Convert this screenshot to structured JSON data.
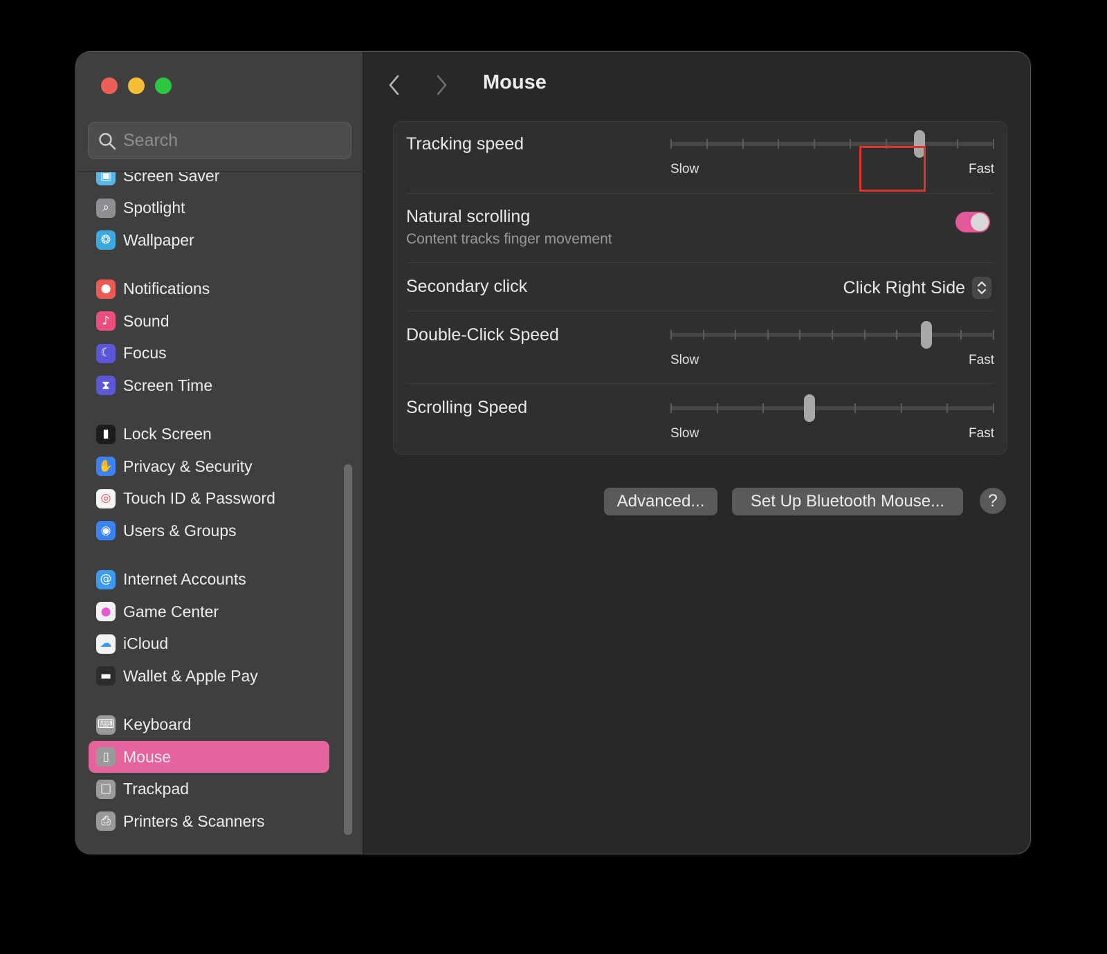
{
  "window": {
    "traffic_lights": {
      "close": "#ec5f57",
      "minimize": "#f3be33",
      "maximize": "#2bc840"
    }
  },
  "search": {
    "placeholder": "Search",
    "icon": "magnifying-glass-icon"
  },
  "sidebar": {
    "items": [
      {
        "label": "Screen Saver",
        "icon": "screen-saver-icon",
        "color": "#57b8e8"
      },
      {
        "label": "Spotlight",
        "icon": "spotlight-icon",
        "color": "#8e8e93"
      },
      {
        "label": "Wallpaper",
        "icon": "wallpaper-icon",
        "color": "#3aa9e0"
      },
      {
        "label": "Notifications",
        "icon": "notifications-icon",
        "color": "#ec5a56"
      },
      {
        "label": "Sound",
        "icon": "sound-icon",
        "color": "#ea4f7d"
      },
      {
        "label": "Focus",
        "icon": "focus-icon",
        "color": "#5b57d6"
      },
      {
        "label": "Screen Time",
        "icon": "screen-time-icon",
        "color": "#5b57d6"
      },
      {
        "label": "Lock Screen",
        "icon": "lock-icon",
        "color": "#1c1c1e"
      },
      {
        "label": "Privacy & Security",
        "icon": "hand-icon",
        "color": "#3b82f6"
      },
      {
        "label": "Touch ID & Password",
        "icon": "fingerprint-icon",
        "color": "#f4f4f4"
      },
      {
        "label": "Users & Groups",
        "icon": "users-icon",
        "color": "#3b82f6"
      },
      {
        "label": "Internet Accounts",
        "icon": "at-icon",
        "color": "#3b9bf0"
      },
      {
        "label": "Game Center",
        "icon": "game-center-icon",
        "color": "#f2f2f2"
      },
      {
        "label": "iCloud",
        "icon": "cloud-icon",
        "color": "#f2f2f2"
      },
      {
        "label": "Wallet & Apple Pay",
        "icon": "wallet-icon",
        "color": "#2c2c2e"
      },
      {
        "label": "Keyboard",
        "icon": "keyboard-icon",
        "color": "#9a9a9a"
      },
      {
        "label": "Mouse",
        "icon": "mouse-icon",
        "color": "#9a9a9a",
        "selected": true
      },
      {
        "label": "Trackpad",
        "icon": "trackpad-icon",
        "color": "#9a9a9a"
      },
      {
        "label": "Printers & Scanners",
        "icon": "printer-icon",
        "color": "#9a9a9a"
      }
    ],
    "selected_color": "#e6639e"
  },
  "header": {
    "title": "Mouse",
    "back_icon": "chevron-left-icon",
    "forward_icon": "chevron-right-icon"
  },
  "settings": {
    "tracking_speed": {
      "label": "Tracking speed",
      "min_label": "Slow",
      "max_label": "Fast",
      "ticks": 10,
      "value": 0.77
    },
    "natural_scrolling": {
      "label": "Natural scrolling",
      "description": "Content tracks finger movement",
      "enabled": true,
      "accent": "#e4599a"
    },
    "secondary_click": {
      "label": "Secondary click",
      "value": "Click Right Side"
    },
    "double_click_speed": {
      "label": "Double-Click Speed",
      "min_label": "Slow",
      "max_label": "Fast",
      "ticks": 11,
      "value": 0.79
    },
    "scrolling_speed": {
      "label": "Scrolling Speed",
      "min_label": "Slow",
      "max_label": "Fast",
      "ticks": 8,
      "value": 0.43
    }
  },
  "buttons": {
    "advanced": "Advanced...",
    "bluetooth": "Set Up Bluetooth Mouse...",
    "help": "?"
  }
}
